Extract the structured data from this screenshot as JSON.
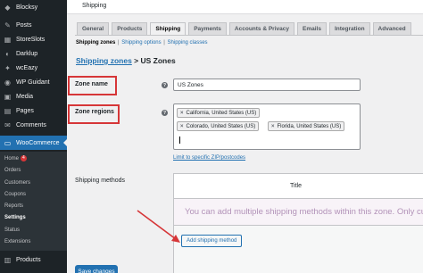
{
  "sidebar": {
    "items": [
      {
        "label": "Blocksy",
        "icon": "blocksy-icon"
      },
      {
        "label": "Posts",
        "icon": "pin-icon"
      },
      {
        "label": "StoreSlots",
        "icon": "slots-icon"
      },
      {
        "label": "Darklup",
        "icon": "darklup-icon"
      },
      {
        "label": "wcEazy",
        "icon": "wceazy-icon"
      },
      {
        "label": "WP Guidant",
        "icon": "guidant-icon"
      },
      {
        "label": "Media",
        "icon": "media-icon"
      },
      {
        "label": "Pages",
        "icon": "pages-icon"
      },
      {
        "label": "Comments",
        "icon": "comments-icon"
      },
      {
        "label": "WooCommerce",
        "icon": "woocommerce-icon"
      }
    ],
    "submenu": [
      {
        "label": "Home",
        "badge": "4"
      },
      {
        "label": "Orders"
      },
      {
        "label": "Customers"
      },
      {
        "label": "Coupons"
      },
      {
        "label": "Reports"
      },
      {
        "label": "Settings"
      },
      {
        "label": "Status"
      },
      {
        "label": "Extensions"
      }
    ],
    "bottom": [
      {
        "label": "Products",
        "icon": "products-icon"
      }
    ]
  },
  "header": {
    "title": "Shipping"
  },
  "tabs": [
    "General",
    "Products",
    "Shipping",
    "Payments",
    "Accounts & Privacy",
    "Emails",
    "Integration",
    "Advanced"
  ],
  "subnav": {
    "zones": "Shipping zones",
    "options": "Shipping options",
    "classes": "Shipping classes",
    "sep": "|"
  },
  "breadcrumb": {
    "link": "Shipping zones",
    "rest": " > US Zones"
  },
  "form": {
    "zone_name_label": "Zone name",
    "zone_name_value": "US Zones",
    "zone_regions_label": "Zone regions",
    "regions": [
      "California, United States (US)",
      "Colorado, United States (US)",
      "Florida, United States (US)"
    ],
    "remove_glyph": "×",
    "help_glyph": "?",
    "postcode_link": "Limit to specific ZIP/postcodes",
    "shipping_methods_label": "Shipping methods",
    "table_title": "Title",
    "empty_message": "You can add multiple shipping methods within this zone. Only customers within the zone will see them.",
    "add_method_button": "Add shipping method",
    "save_button": "Save changes"
  },
  "colors": {
    "accent": "#2271b1",
    "sidebar_bg": "#1d2327",
    "highlight": "#d63638"
  }
}
